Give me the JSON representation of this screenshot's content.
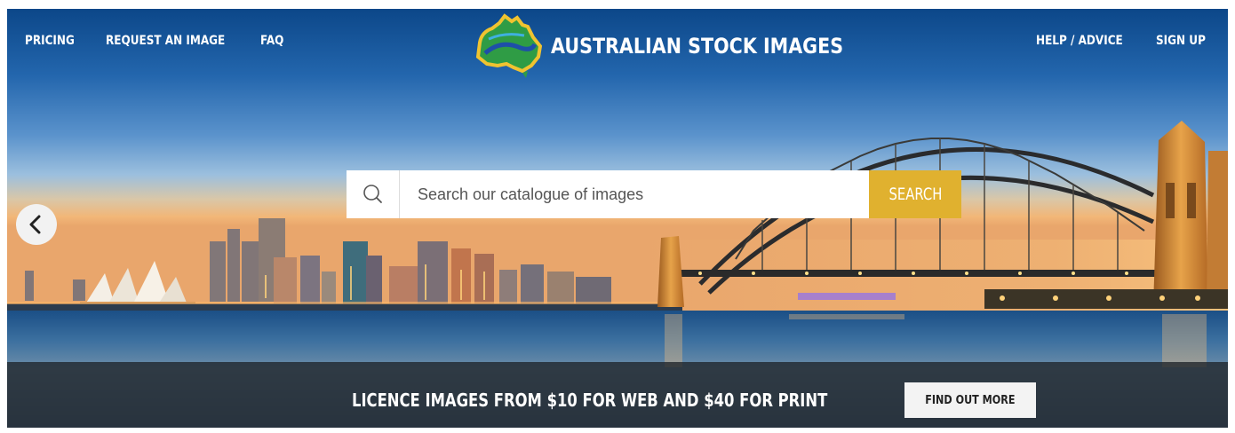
{
  "header": {
    "nav_left": [
      {
        "label": "PRICING"
      },
      {
        "label": "REQUEST AN IMAGE"
      },
      {
        "label": "FAQ"
      }
    ],
    "nav_right": [
      {
        "label": "HELP / ADVICE"
      },
      {
        "label": "SIGN UP"
      }
    ],
    "logo_text": "AUSTRALIAN STOCK IMAGES",
    "logo_icon": "australia-map-icon"
  },
  "search": {
    "placeholder": "Search our catalogue of images",
    "value": "",
    "button_label": "SEARCH",
    "icon": "search-icon"
  },
  "carousel": {
    "prev_icon": "chevron-left-icon"
  },
  "promo": {
    "text": "LICENCE IMAGES FROM $10 FOR WEB AND $40 FOR PRINT",
    "button_label": "FIND OUT MORE"
  },
  "colors": {
    "accent": "#e0b12f",
    "promo_bar": "#1e2228",
    "sky_top": "#0d4a8a",
    "sky_horizon": "#f0b979"
  }
}
